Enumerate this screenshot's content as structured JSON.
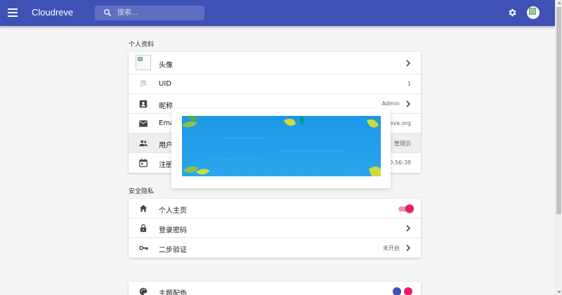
{
  "app": {
    "title": "Cloudreve",
    "search_placeholder": "搜索...",
    "accent_color": "#3f51b5"
  },
  "icons": {
    "menu": "menu-icon",
    "search": "search-icon",
    "settings": "gear-icon",
    "avatar": "avatar"
  },
  "profile": {
    "section_title": "个人资料",
    "rows": [
      {
        "label": "头像",
        "value": "",
        "icon": "avatar-image"
      },
      {
        "label": "UID",
        "value": "1",
        "icon": "fingerprint-icon"
      },
      {
        "label": "昵称",
        "value": "Admin",
        "icon": "contact-card-icon"
      },
      {
        "label": "Ema",
        "value": "eve.org",
        "icon": "mail-icon"
      },
      {
        "label": "用户",
        "value": "管理员",
        "icon": "group-icon"
      },
      {
        "label": "注册",
        "value": "0:56:38",
        "icon": "calendar-icon"
      }
    ]
  },
  "security": {
    "section_title": "安全隐私",
    "rows": [
      {
        "label": "个人主页",
        "icon": "home-icon",
        "toggle_on": true
      },
      {
        "label": "登录密码",
        "icon": "lock-icon",
        "value": ""
      },
      {
        "label": "二步验证",
        "icon": "key-icon",
        "value": "未开启"
      }
    ]
  },
  "theme": {
    "rows": [
      {
        "label": "主题配色",
        "icon": "palette-icon",
        "swatches": [
          "#3f51b5",
          "#e91e63"
        ]
      }
    ]
  }
}
